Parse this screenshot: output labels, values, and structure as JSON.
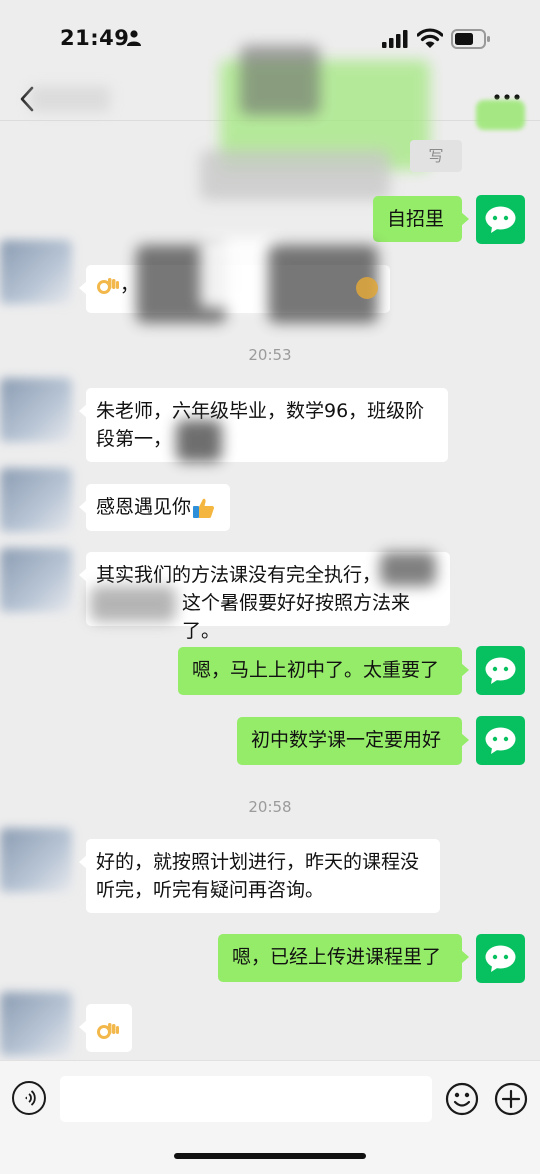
{
  "status_bar": {
    "time": "21:49"
  },
  "nav": {
    "more_label": "···"
  },
  "messages": {
    "top_partial": "写",
    "m1": "自招里",
    "m2_prefix": "，",
    "ts1": "20:53",
    "m3": "朱老师，六年级毕业，数学96，班级阶段第一，",
    "m4": "感恩遇见你",
    "m5_line1": "其实我们的方法课没有完全执行，",
    "m5_line2": "这个暑假要好好按照方法来了。",
    "m6": "嗯，马上上初中了。太重要了",
    "m7": "初中数学课一定要用好",
    "ts2": "20:58",
    "m8": "好的，就按照计划进行，昨天的课程没听完，听完有疑问再咨询。",
    "m9": "嗯，已经上传进课程里了"
  },
  "input": {
    "value": "",
    "placeholder": ""
  },
  "colors": {
    "background": "#ededed",
    "sent_bubble": "#95ec69",
    "received_bubble": "#ffffff",
    "wechat_green": "#07c160"
  },
  "icons": {
    "person": "person-icon",
    "signal": "signal-icon",
    "wifi": "wifi-icon",
    "battery": "battery-icon",
    "back": "chevron-left-icon",
    "more": "more-icon",
    "ok_hand": "ok-hand-emoji",
    "thumbs_up": "thumbs-up-emoji",
    "voice": "voice-icon",
    "emoji": "smiley-icon",
    "plus": "plus-icon",
    "wechat": "wechat-logo-icon"
  }
}
